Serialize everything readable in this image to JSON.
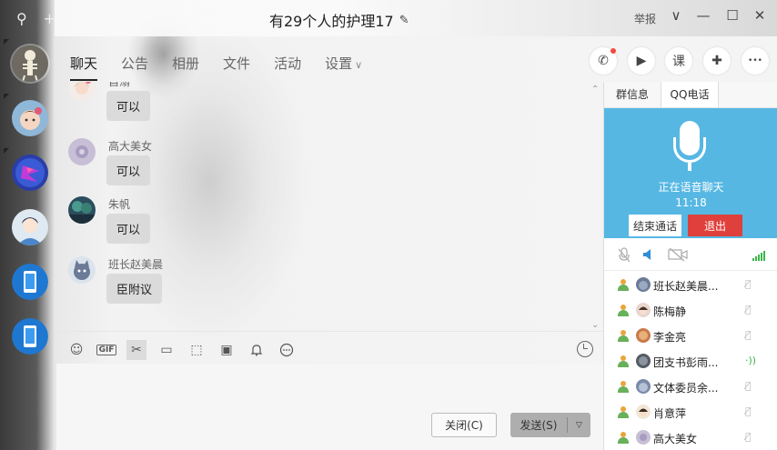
{
  "window": {
    "title": "有29个人的护理17",
    "report_label": "举报",
    "controls": {
      "dropdown": "∨",
      "minimize": "—",
      "maximize": "☐",
      "close": "✕"
    }
  },
  "rail": {
    "search_glyph": "⚲",
    "add_glyph": "+",
    "items": [
      "skeleton-avatar",
      "girl-avatar",
      "app-avatar",
      "cartoon-avatar",
      "phone-app",
      "phone-app"
    ]
  },
  "tabs": [
    {
      "label": "聊天",
      "active": true
    },
    {
      "label": "公告"
    },
    {
      "label": "相册"
    },
    {
      "label": "文件"
    },
    {
      "label": "活动"
    },
    {
      "label": "设置",
      "has_dropdown": true
    }
  ],
  "actions": [
    {
      "name": "phone-call-button",
      "glyph": "✆",
      "badge": true
    },
    {
      "name": "video-call-button",
      "glyph": "▶"
    },
    {
      "name": "class-button",
      "glyph": "课"
    },
    {
      "name": "add-app-button",
      "glyph": "✚"
    },
    {
      "name": "more-button",
      "glyph": "•••"
    }
  ],
  "messages": [
    {
      "name": "自溺",
      "text": "可以"
    },
    {
      "name": "高大美女",
      "text": "可以"
    },
    {
      "name": "朱帆",
      "text": "可以"
    },
    {
      "name": "班长赵美晨",
      "text": "臣附议"
    }
  ],
  "toolbar": {
    "tools": [
      {
        "name": "emoji-icon",
        "glyph": "☺"
      },
      {
        "name": "gif-icon",
        "glyph": "GIF"
      },
      {
        "name": "scissors-icon",
        "glyph": "✂"
      },
      {
        "name": "folder-icon",
        "glyph": "▭"
      },
      {
        "name": "sticker-icon",
        "glyph": "⬚"
      },
      {
        "name": "image-icon",
        "glyph": "▣"
      },
      {
        "name": "bell-icon",
        "glyph": "♫"
      },
      {
        "name": "more-icon",
        "glyph": "⋯"
      }
    ]
  },
  "input": {
    "close_label": "关闭(C)",
    "send_label": "发送(S)"
  },
  "panel": {
    "tabs": [
      "群信息",
      "QQ电话"
    ],
    "voice": {
      "status": "正在语音聊天",
      "time": "11:18",
      "end_label": "结束通话",
      "exit_label": "退出"
    },
    "members": [
      {
        "name": "班长赵美晨...",
        "speaking": false
      },
      {
        "name": "陈梅静",
        "speaking": false
      },
      {
        "name": "李金亮",
        "speaking": false
      },
      {
        "name": "团支书彭雨...",
        "speaking": true
      },
      {
        "name": "文体委员余...",
        "speaking": false
      },
      {
        "name": "肖意萍",
        "speaking": false
      },
      {
        "name": "高大美女",
        "speaking": false
      }
    ]
  },
  "colors": {
    "accent_blue": "#56b7e3",
    "exit_red": "#e0403b",
    "signal_green": "#3bb549"
  }
}
